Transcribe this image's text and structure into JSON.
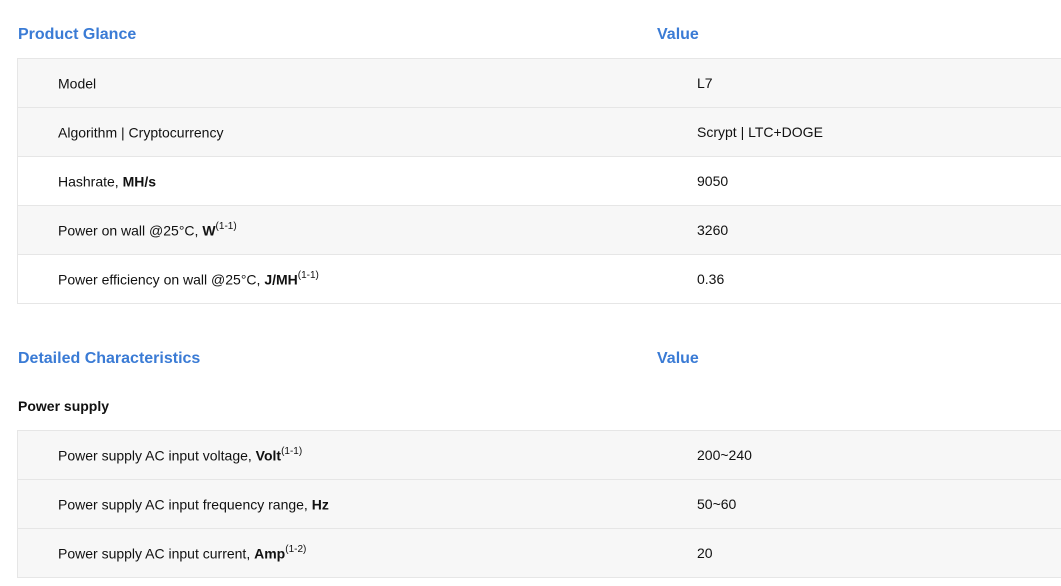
{
  "glance": {
    "header": {
      "title": "Product Glance",
      "value_col": "Value"
    },
    "rows": [
      {
        "label": "Model",
        "unit": "",
        "note": "",
        "value": "L7"
      },
      {
        "label": "Algorithm | Cryptocurrency",
        "unit": "",
        "note": "",
        "value": "Scrypt | LTC+DOGE"
      },
      {
        "label": "Hashrate, ",
        "unit": "MH/s",
        "note": "",
        "value": "9050"
      },
      {
        "label": "Power on wall @25°C, ",
        "unit": "W",
        "note": "(1-1)",
        "value": "3260"
      },
      {
        "label": "Power efficiency on wall @25°C, ",
        "unit": "J/MH",
        "note": "(1-1)",
        "value": "0.36"
      }
    ]
  },
  "detailed": {
    "header": {
      "title": "Detailed Characteristics",
      "value_col": "Value"
    },
    "subheading": "Power supply",
    "rows": [
      {
        "label": "Power supply AC input voltage, ",
        "unit": "Volt",
        "note": "(1-1)",
        "value": "200~240"
      },
      {
        "label": "Power supply AC input frequency range, ",
        "unit": "Hz",
        "note": "",
        "value": "50~60"
      },
      {
        "label": "Power supply AC input current, ",
        "unit": "Amp",
        "note": "(1-2)",
        "value": "20"
      }
    ]
  },
  "colors": {
    "heading": "#3a7bd5",
    "row_alt": "#f7f7f7",
    "border": "#e6e6e6",
    "text": "#111111"
  }
}
